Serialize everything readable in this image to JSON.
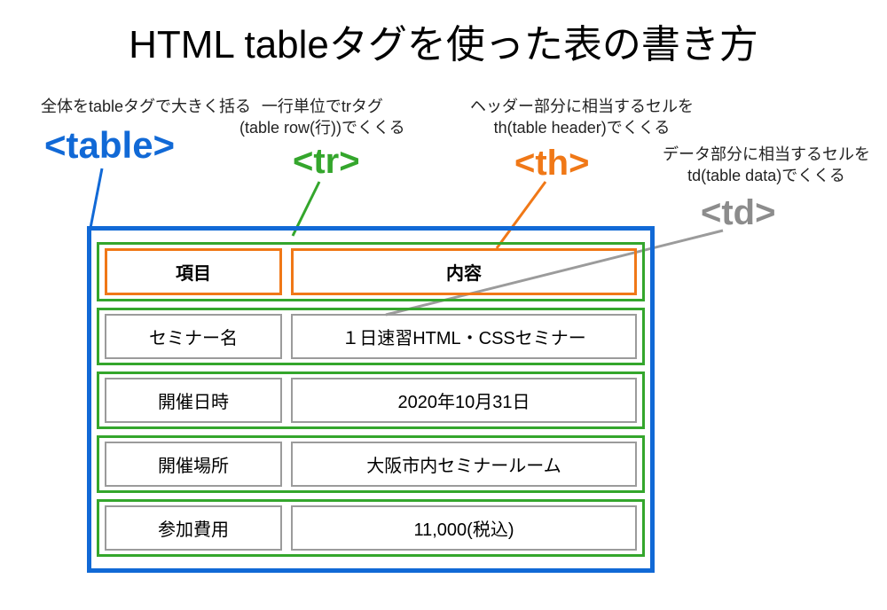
{
  "title": "HTML tableタグを使った表の書き方",
  "annos": {
    "table_note": "全体をtableタグで大きく括る",
    "tr_note_line1": "一行単位でtrタグ",
    "tr_note_line2": "(table row(行))でくくる",
    "th_note_line1": "ヘッダー部分に相当するセルを",
    "th_note_line2": "th(table header)でくくる",
    "td_note_line1": "データ部分に相当するセルを",
    "td_note_line2": "td(table data)でくくる"
  },
  "tags": {
    "table": "<table>",
    "tr": "<tr>",
    "th": "<th>",
    "td": "<td>"
  },
  "headers": {
    "col1": "項目",
    "col2": "内容"
  },
  "rows": [
    {
      "col1": "セミナー名",
      "col2": "１日速習HTML・CSSセミナー"
    },
    {
      "col1": "開催日時",
      "col2": "2020年10月31日"
    },
    {
      "col1": "開催場所",
      "col2": "大阪市内セミナールーム"
    },
    {
      "col1": "参加費用",
      "col2": "11,000(税込)"
    }
  ],
  "colors": {
    "table_border": "#1169d6",
    "tr_border": "#34a62c",
    "th_border": "#f07817",
    "td_border": "#9b9b9b"
  }
}
